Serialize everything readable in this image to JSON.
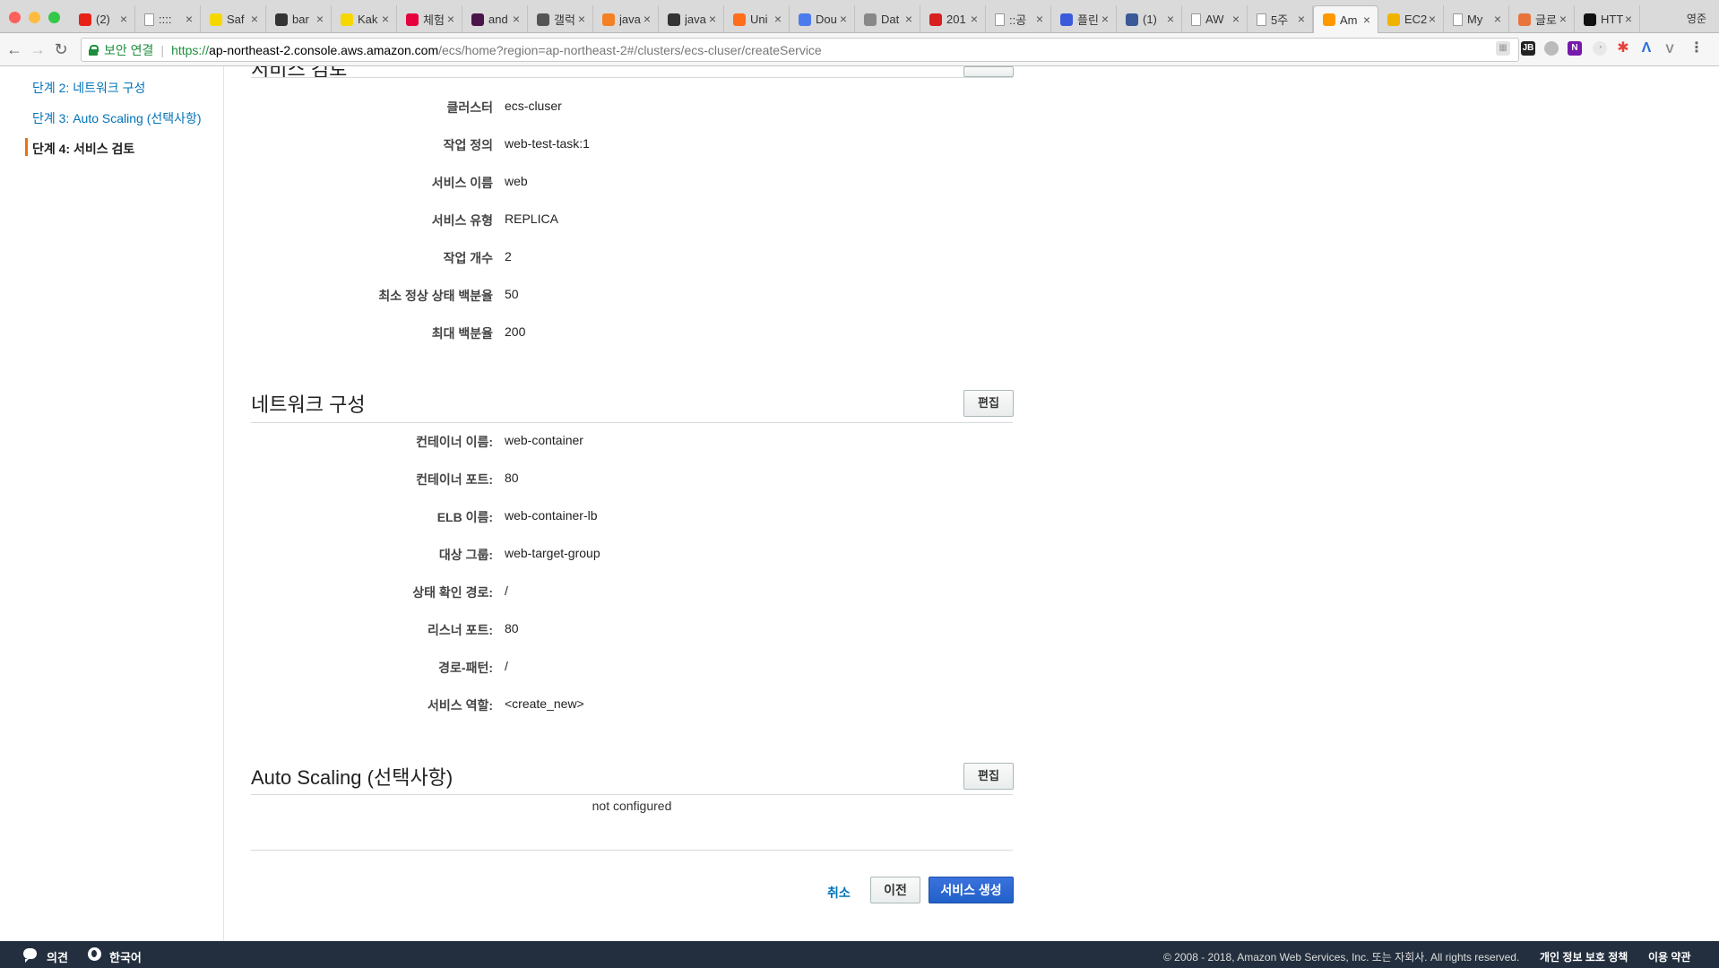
{
  "browser": {
    "tabs": [
      {
        "label": "(2)",
        "icon": "youtube-icon",
        "color": "#e62117"
      },
      {
        "label": "::::",
        "icon": "page-icon",
        "color": "#ffffff"
      },
      {
        "label": "Saf",
        "icon": "k-logo-icon",
        "color": "#f5d800"
      },
      {
        "label": "bar",
        "icon": "github-icon",
        "color": "#333333"
      },
      {
        "label": "Kak",
        "icon": "k-logo-icon",
        "color": "#f5d800"
      },
      {
        "label": "체험",
        "icon": "red-badge-icon",
        "color": "#e6003e"
      },
      {
        "label": "and",
        "icon": "slack-hash-icon",
        "color": "#4a154b"
      },
      {
        "label": "갤럭",
        "icon": "spiral-icon",
        "color": "#555555"
      },
      {
        "label": "java",
        "icon": "stackoverflow-icon",
        "color": "#f48024"
      },
      {
        "label": "java",
        "icon": "github-icon",
        "color": "#333333"
      },
      {
        "label": "Uni",
        "icon": "orange-circle-icon",
        "color": "#ff6e1a"
      },
      {
        "label": "Dou",
        "icon": "kotlin-icon",
        "color": "#4b7bec"
      },
      {
        "label": "Dat",
        "icon": "location-pin-icon",
        "color": "#888888"
      },
      {
        "label": "201",
        "icon": "up-badge-icon",
        "color": "#d81e1e"
      },
      {
        "label": "::공",
        "icon": "page-icon",
        "color": "#ffffff"
      },
      {
        "label": "플린",
        "icon": "fm-badge-icon",
        "color": "#3b5bdb"
      },
      {
        "label": "(1)",
        "icon": "facebook-icon",
        "color": "#3b5998"
      },
      {
        "label": "AW",
        "icon": "page-icon",
        "color": "#ffffff"
      },
      {
        "label": "5주",
        "icon": "page-icon",
        "color": "#ffffff"
      },
      {
        "label": "Am",
        "icon": "aws-cube-icon",
        "color": "#ff9900",
        "active": true
      },
      {
        "label": "EC2",
        "icon": "box-icon",
        "color": "#f0b400"
      },
      {
        "label": "My",
        "icon": "page-icon",
        "color": "#ffffff"
      },
      {
        "label": "글로",
        "icon": "orange-square-icon",
        "color": "#e8743b"
      },
      {
        "label": "HTT",
        "icon": "black-circle-icon",
        "color": "#111111"
      }
    ],
    "profile_name": "영준",
    "secure_label": "보안 연결",
    "url_scheme": "https://",
    "url_host": "ap-northeast-2.console.aws.amazon.com",
    "url_path": "/ecs/home?region=ap-northeast-2#/clusters/ecs-cluser/createService"
  },
  "sidebar": {
    "steps": [
      {
        "label": "단계 2: 네트워크 구성",
        "current": false
      },
      {
        "label": "단계 3: Auto Scaling (선택사항)",
        "current": false
      },
      {
        "label": "단계 4: 서비스 검토",
        "current": true
      }
    ]
  },
  "service_review": {
    "title": "서비스 검토",
    "edit_label": "편집",
    "rows": [
      {
        "label": "클러스터",
        "value": "ecs-cluser"
      },
      {
        "label": "작업 정의",
        "value": "web-test-task:1"
      },
      {
        "label": "서비스 이름",
        "value": "web"
      },
      {
        "label": "서비스 유형",
        "value": "REPLICA"
      },
      {
        "label": "작업 개수",
        "value": "2"
      },
      {
        "label": "최소 정상 상태 백분율",
        "value": "50"
      },
      {
        "label": "최대 백분율",
        "value": "200"
      }
    ]
  },
  "network": {
    "title": "네트워크 구성",
    "edit_label": "편집",
    "rows": [
      {
        "label": "컨테이너 이름:",
        "value": "web-container"
      },
      {
        "label": "컨테이너 포트:",
        "value": "80"
      },
      {
        "label": "ELB 이름:",
        "value": "web-container-lb"
      },
      {
        "label": "대상 그룹:",
        "value": "web-target-group"
      },
      {
        "label": "상태 확인 경로:",
        "value": "/"
      },
      {
        "label": "리스너 포트:",
        "value": "80"
      },
      {
        "label": "경로-패턴:",
        "value": "/"
      },
      {
        "label": "서비스 역할:",
        "value": "<create_new>"
      }
    ]
  },
  "autoscaling": {
    "title": "Auto Scaling (선택사항)",
    "edit_label": "편집",
    "status": "not configured"
  },
  "actions": {
    "cancel": "취소",
    "previous": "이전",
    "create": "서비스 생성"
  },
  "footer": {
    "feedback": "의견",
    "language": "한국어",
    "copyright": "© 2008 - 2018, Amazon Web Services, Inc. 또는 자회사. All rights reserved.",
    "privacy": "개인 정보 보호 정책",
    "terms": "이용 약관"
  },
  "colors": {
    "accent_orange": "#ec7211",
    "link_blue": "#0073bb",
    "primary_button": "#2160c9",
    "footer_bg": "#232f3e"
  }
}
